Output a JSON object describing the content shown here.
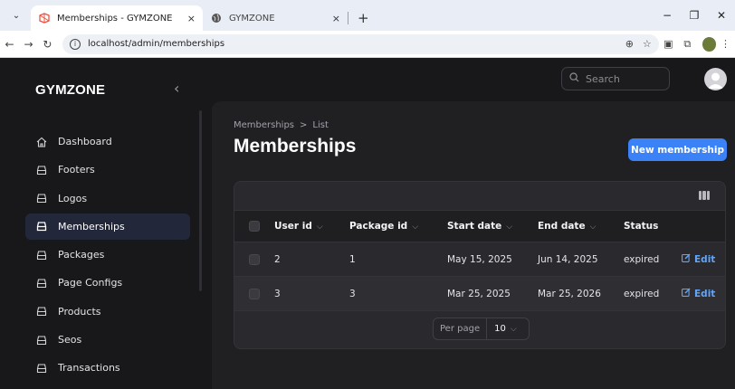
{
  "browser": {
    "tabs": [
      {
        "title": "Memberships - GYMZONE",
        "active": true
      },
      {
        "title": "GYMZONE",
        "active": false
      }
    ],
    "url": "localhost/admin/memberships",
    "close_glyph": "×",
    "new_tab_glyph": "+"
  },
  "app": {
    "brand": "GYMZONE",
    "search_placeholder": "Search",
    "nav": [
      {
        "label": "Dashboard",
        "icon": "home-icon",
        "active": false
      },
      {
        "label": "Footers",
        "icon": "tray-icon",
        "active": false
      },
      {
        "label": "Logos",
        "icon": "tray-icon",
        "active": false
      },
      {
        "label": "Memberships",
        "icon": "tray-icon",
        "active": true
      },
      {
        "label": "Packages",
        "icon": "tray-icon",
        "active": false
      },
      {
        "label": "Page Configs",
        "icon": "tray-icon",
        "active": false
      },
      {
        "label": "Products",
        "icon": "tray-icon",
        "active": false
      },
      {
        "label": "Seos",
        "icon": "tray-icon",
        "active": false
      },
      {
        "label": "Transactions",
        "icon": "tray-icon",
        "active": false
      }
    ]
  },
  "page": {
    "breadcrumb": [
      "Memberships",
      "List"
    ],
    "breadcrumb_sep": ">",
    "title": "Memberships",
    "new_button": "New membership"
  },
  "table": {
    "columns": [
      "User id",
      "Package id",
      "Start date",
      "End date",
      "Status"
    ],
    "rows": [
      {
        "user_id": "2",
        "package_id": "1",
        "start_date": "May 15, 2025",
        "end_date": "Jun 14, 2025",
        "status": "expired",
        "action": "Edit"
      },
      {
        "user_id": "3",
        "package_id": "3",
        "start_date": "Mar 25, 2025",
        "end_date": "Mar 25, 2026",
        "status": "expired",
        "action": "Edit"
      }
    ],
    "per_page_label": "Per page",
    "per_page_value": "10"
  },
  "colors": {
    "accent": "#3b82f6",
    "link": "#60a5fa",
    "background": "#18181b"
  }
}
